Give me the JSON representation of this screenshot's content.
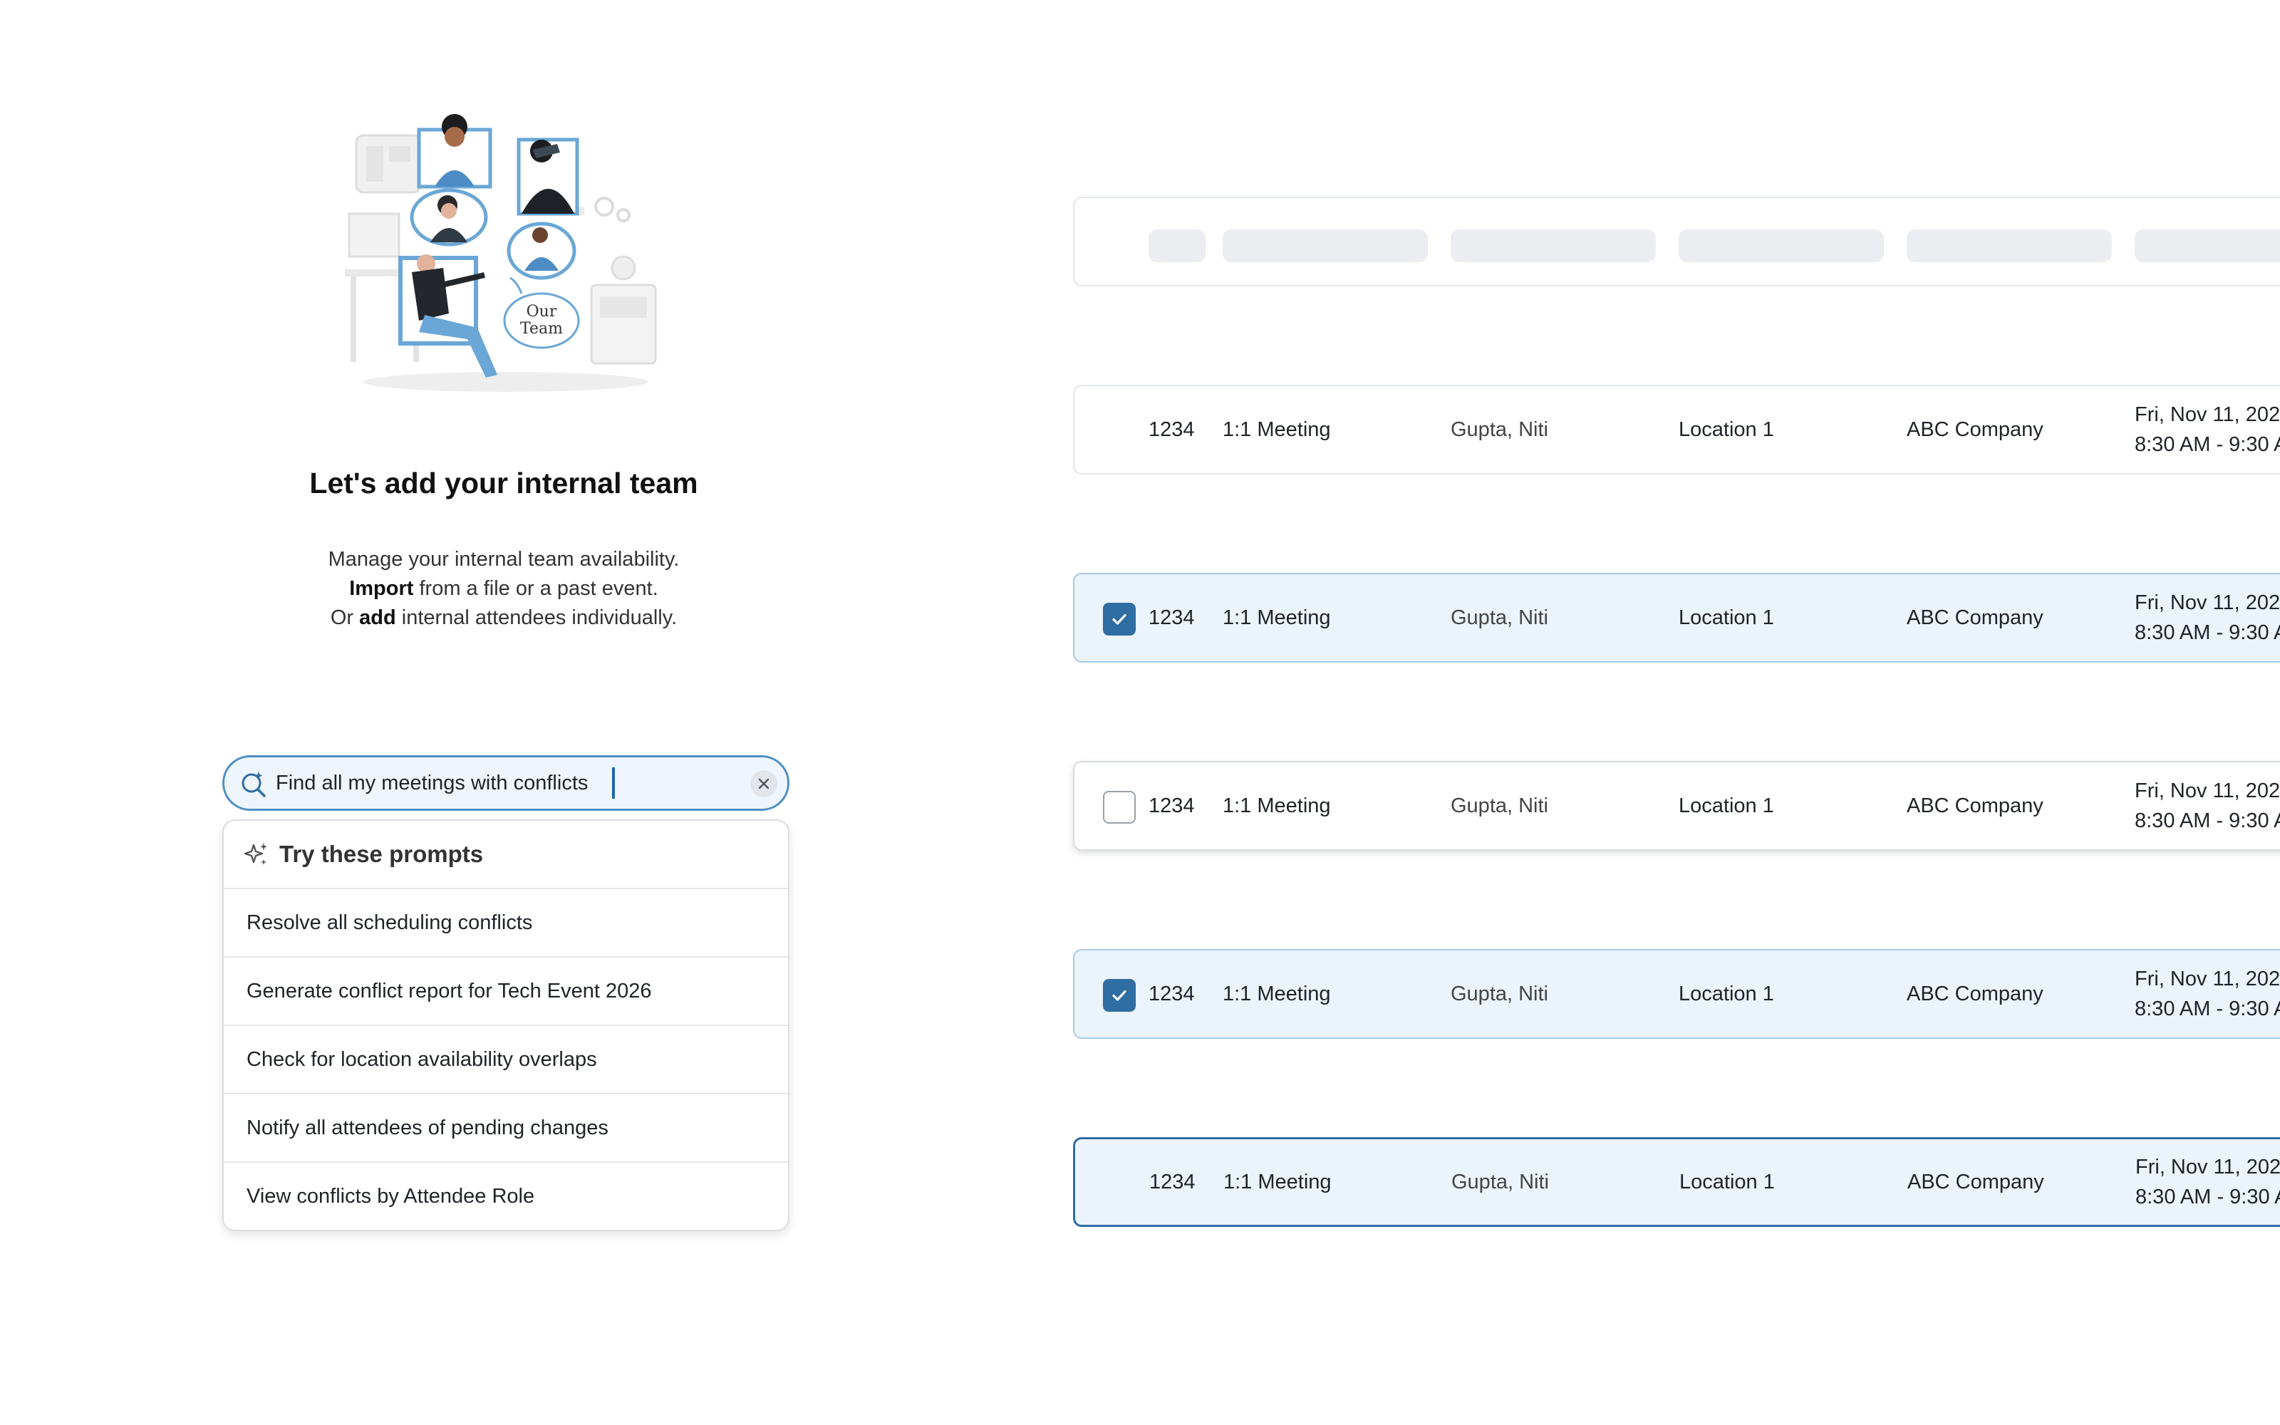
{
  "empty_state": {
    "title": "Let's add your internal team",
    "line1": "Manage your internal team availability.",
    "line2_bold": "Import",
    "line2_rest": " from a file or a past event.",
    "line3_pre": "Or ",
    "line3_bold": "add",
    "line3_rest": " internal attendees individually.",
    "illustration_sign_line1": "Our",
    "illustration_sign_line2": "Team"
  },
  "search": {
    "value": "Find all my meetings with conflicts",
    "icon": "ai-search-icon",
    "clear_icon": "close-icon"
  },
  "prompts": {
    "heading": "Try these prompts",
    "icon": "sparkle-icon",
    "items": [
      "Resolve all scheduling conflicts",
      "Generate conflict report for Tech Event 2026",
      "Check for location availability overlaps",
      "Notify all attendees of pending changes",
      "View conflicts by Attendee Role"
    ]
  },
  "rows": [
    {
      "state": "default",
      "checkbox": "none",
      "id": "1234",
      "type": "1:1 Meeting",
      "name": "Gupta, Niti",
      "location": "Location 1",
      "company": "ABC Company",
      "date": "Fri, Nov 11, 202",
      "time": "8:30 AM - 9:30 A"
    },
    {
      "state": "selected",
      "checkbox": "checked",
      "id": "1234",
      "type": "1:1 Meeting",
      "name": "Gupta, Niti",
      "location": "Location 1",
      "company": "ABC Company",
      "date": "Fri, Nov 11, 202",
      "time": "8:30 AM - 9:30 A"
    },
    {
      "state": "hover",
      "checkbox": "unchecked",
      "id": "1234",
      "type": "1:1 Meeting",
      "name": "Gupta, Niti",
      "location": "Location 1",
      "company": "ABC Company",
      "date": "Fri, Nov 11, 202",
      "time": "8:30 AM - 9:30 A"
    },
    {
      "state": "selected",
      "checkbox": "checked",
      "id": "1234",
      "type": "1:1 Meeting",
      "name": "Gupta, Niti",
      "location": "Location 1",
      "company": "ABC Company",
      "date": "Fri, Nov 11, 202",
      "time": "8:30 AM - 9:30 A"
    },
    {
      "state": "focused",
      "checkbox": "none",
      "id": "1234",
      "type": "1:1 Meeting",
      "name": "Gupta, Niti",
      "location": "Location 1",
      "company": "ABC Company",
      "date": "Fri, Nov 11, 202",
      "time": "8:30 AM - 9:30 A"
    }
  ],
  "colors": {
    "accent": "#2f6da3",
    "selected_row_bg": "#ebf3fb",
    "search_border": "#4f8fc4",
    "skeleton": "#ebedf0"
  }
}
